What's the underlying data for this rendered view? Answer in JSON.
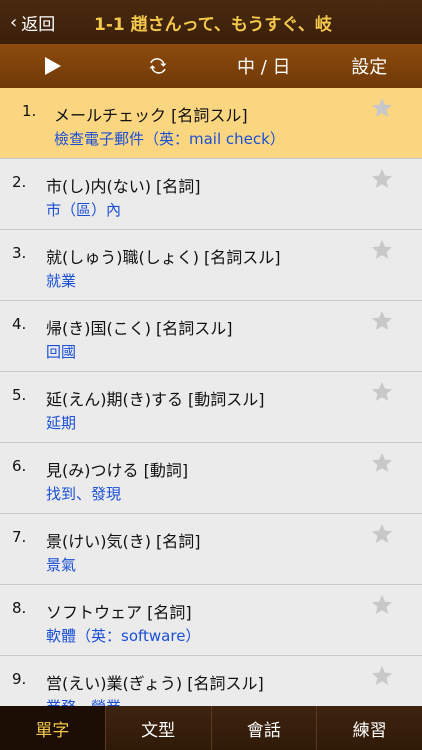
{
  "header": {
    "back_label": "返回",
    "title": "1-1 趙さんって、もうすぐ、岐"
  },
  "toolbar": {
    "lang_toggle": "中 / 日",
    "settings": "設定"
  },
  "list": {
    "items": [
      {
        "num": "1.",
        "jp": "メールチェック  [名詞スル]",
        "zh": "檢查電子郵件（英：mail check）"
      },
      {
        "num": "2.",
        "jp": "市(し)内(ない)  [名詞]",
        "zh": "市（區）內"
      },
      {
        "num": "3.",
        "jp": "就(しゅう)職(しょく)  [名詞スル]",
        "zh": "就業"
      },
      {
        "num": "4.",
        "jp": "帰(き)国(こく)  [名詞スル]",
        "zh": "回國"
      },
      {
        "num": "5.",
        "jp": "延(えん)期(き)する  [動詞スル]",
        "zh": "延期"
      },
      {
        "num": "6.",
        "jp": "見(み)つける  [動詞]",
        "zh": "找到、發現"
      },
      {
        "num": "7.",
        "jp": "景(けい)気(き)  [名詞]",
        "zh": "景氣"
      },
      {
        "num": "8.",
        "jp": "ソフトウェア  [名詞]",
        "zh": "軟體（英：software）"
      },
      {
        "num": "9.",
        "jp": "営(えい)業(ぎょう)  [名詞スル]",
        "zh": "業務、營業"
      }
    ]
  },
  "tabs": [
    "單字",
    "文型",
    "會話",
    "練習"
  ],
  "colors": {
    "title": "#f3c84b",
    "selected_row": "#fbd680",
    "translation": "#1a4fd6"
  }
}
